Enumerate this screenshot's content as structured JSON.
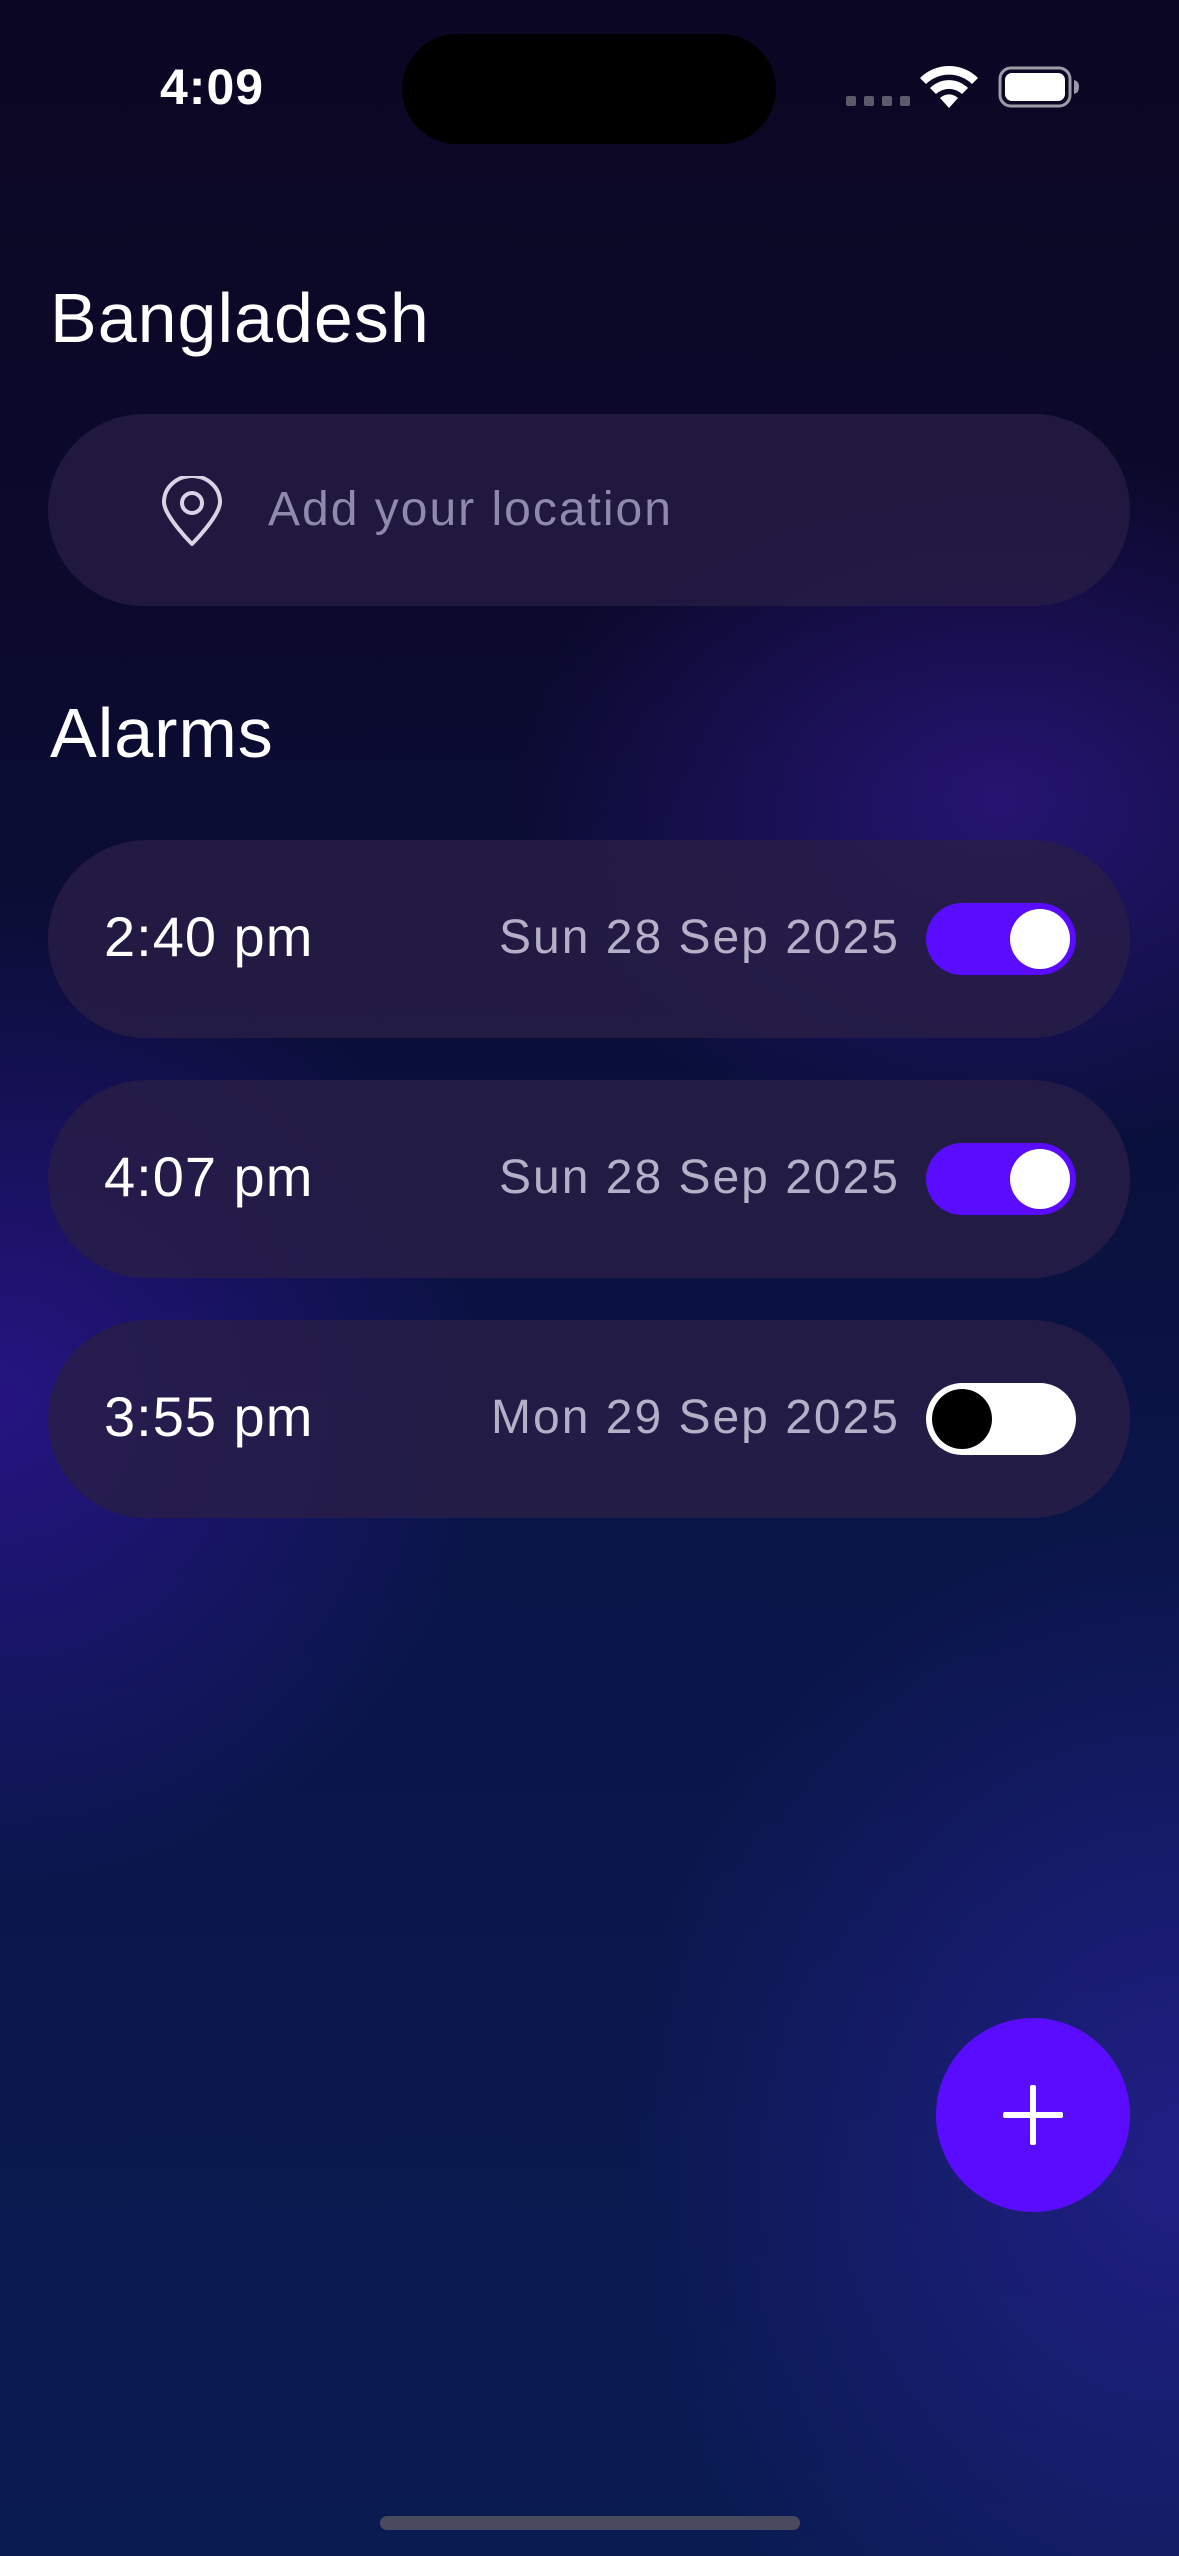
{
  "status_bar": {
    "time": "4:09",
    "icons": [
      "signal-icon",
      "wifi-icon",
      "battery-icon"
    ]
  },
  "location": {
    "title": "Bangladesh",
    "placeholder": "Add your location",
    "icon": "pin-icon"
  },
  "alarms": {
    "title": "Alarms",
    "items": [
      {
        "time": "2:40 pm",
        "date": "Sun 28 Sep 2025",
        "enabled": true
      },
      {
        "time": "4:07 pm",
        "date": "Sun 28 Sep 2025",
        "enabled": true
      },
      {
        "time": "3:55 pm",
        "date": "Mon 29 Sep 2025",
        "enabled": false
      }
    ]
  },
  "fab": {
    "icon": "plus-icon"
  },
  "colors": {
    "accent": "#5a0cff",
    "card": "#281e46",
    "background_top": "#0b0622",
    "background_bottom": "#0a1b52",
    "secondary_text": "#b5b0c8",
    "placeholder_text": "#8f8aab"
  }
}
